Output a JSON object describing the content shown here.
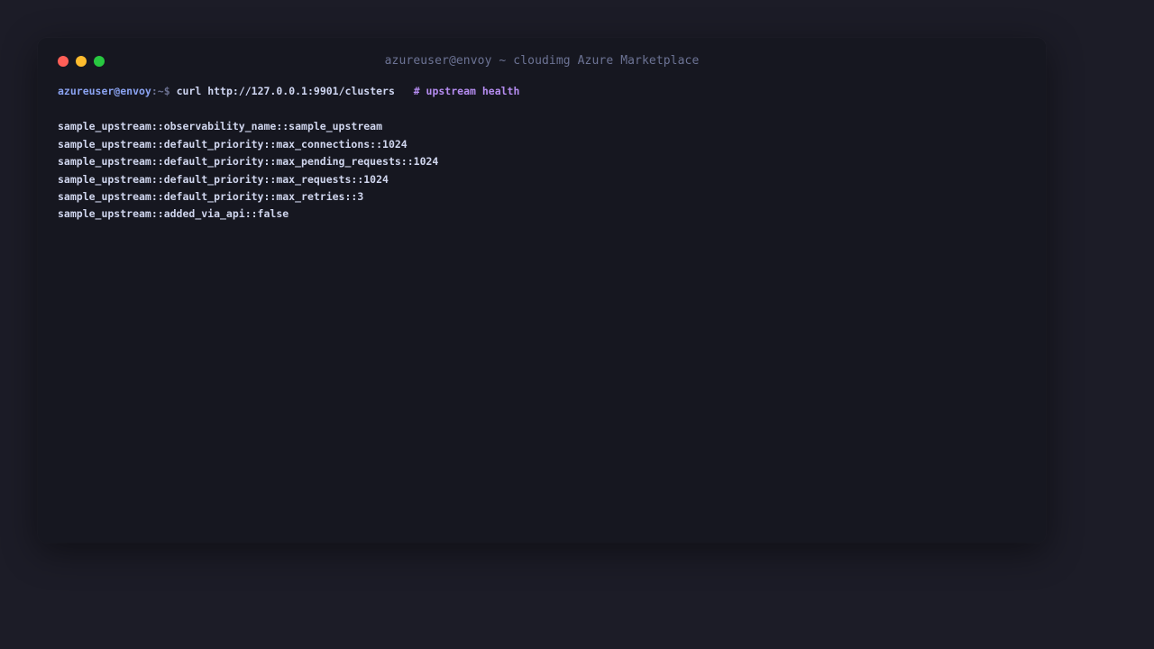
{
  "window": {
    "title": "azureuser@envoy ~ cloudimg Azure Marketplace"
  },
  "prompt": {
    "user_host": "azureuser@envoy",
    "path": ":~$",
    "command": "curl http://127.0.0.1:9901/clusters",
    "comment": "# upstream health"
  },
  "output": [
    "sample_upstream::observability_name::sample_upstream",
    "sample_upstream::default_priority::max_connections::1024",
    "sample_upstream::default_priority::max_pending_requests::1024",
    "sample_upstream::default_priority::max_requests::1024",
    "sample_upstream::default_priority::max_retries::3",
    "sample_upstream::added_via_api::false"
  ],
  "colors": {
    "close": "#ff5f57",
    "minimize": "#febc2e",
    "maximize": "#28c840",
    "prompt_user": "#8aa2f0",
    "comment": "#b58cf0"
  }
}
